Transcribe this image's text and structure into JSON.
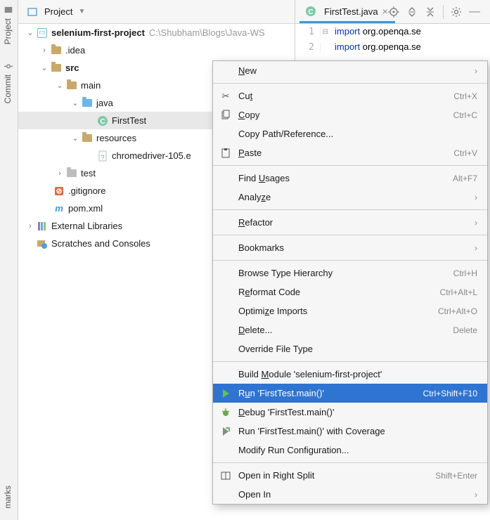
{
  "side_tabs": {
    "project": "Project",
    "commit": "Commit",
    "bookmarks": "marks"
  },
  "toolbar": {
    "title": "Project"
  },
  "tree": {
    "root": {
      "name": "selenium-first-project",
      "path": "C:\\Shubham\\Blogs\\Java-WS"
    },
    "idea": ".idea",
    "src": "src",
    "main": "main",
    "java": "java",
    "firsttest": "FirstTest",
    "resources": "resources",
    "chromedriver": "chromedriver-105.e",
    "test": "test",
    "gitignore": ".gitignore",
    "pom": "pom.xml",
    "extlib": "External Libraries",
    "scratches": "Scratches and Consoles"
  },
  "editor": {
    "tab": "FirstTest.java",
    "lines": [
      {
        "n": "1",
        "code_kw": "import",
        "code_rest": " org.openqa.se"
      },
      {
        "n": "2",
        "code_kw": "import",
        "code_rest": " org.openqa.se"
      }
    ]
  },
  "ctx": {
    "new": "New",
    "cut": {
      "label": "Cut",
      "sc": "Ctrl+X"
    },
    "copy": {
      "label": "Copy",
      "sc": "Ctrl+C"
    },
    "copypath": "Copy Path/Reference...",
    "paste": {
      "label": "Paste",
      "sc": "Ctrl+V"
    },
    "findusages": {
      "label": "Find Usages",
      "sc": "Alt+F7"
    },
    "analyze": "Analyze",
    "refactor": "Refactor",
    "bookmarks": "Bookmarks",
    "browsehier": {
      "label": "Browse Type Hierarchy",
      "sc": "Ctrl+H"
    },
    "reformat": {
      "label": "Reformat Code",
      "sc": "Ctrl+Alt+L"
    },
    "optimize": {
      "label": "Optimize Imports",
      "sc": "Ctrl+Alt+O"
    },
    "delete": {
      "label": "Delete...",
      "sc": "Delete"
    },
    "override": "Override File Type",
    "build": "Build Module 'selenium-first-project'",
    "run": {
      "label": "Run 'FirstTest.main()'",
      "sc": "Ctrl+Shift+F10"
    },
    "debug": "Debug 'FirstTest.main()'",
    "coverage": "Run 'FirstTest.main()' with Coverage",
    "modify": "Modify Run Configuration...",
    "openright": {
      "label": "Open in Right Split",
      "sc": "Shift+Enter"
    },
    "openin": "Open In"
  }
}
